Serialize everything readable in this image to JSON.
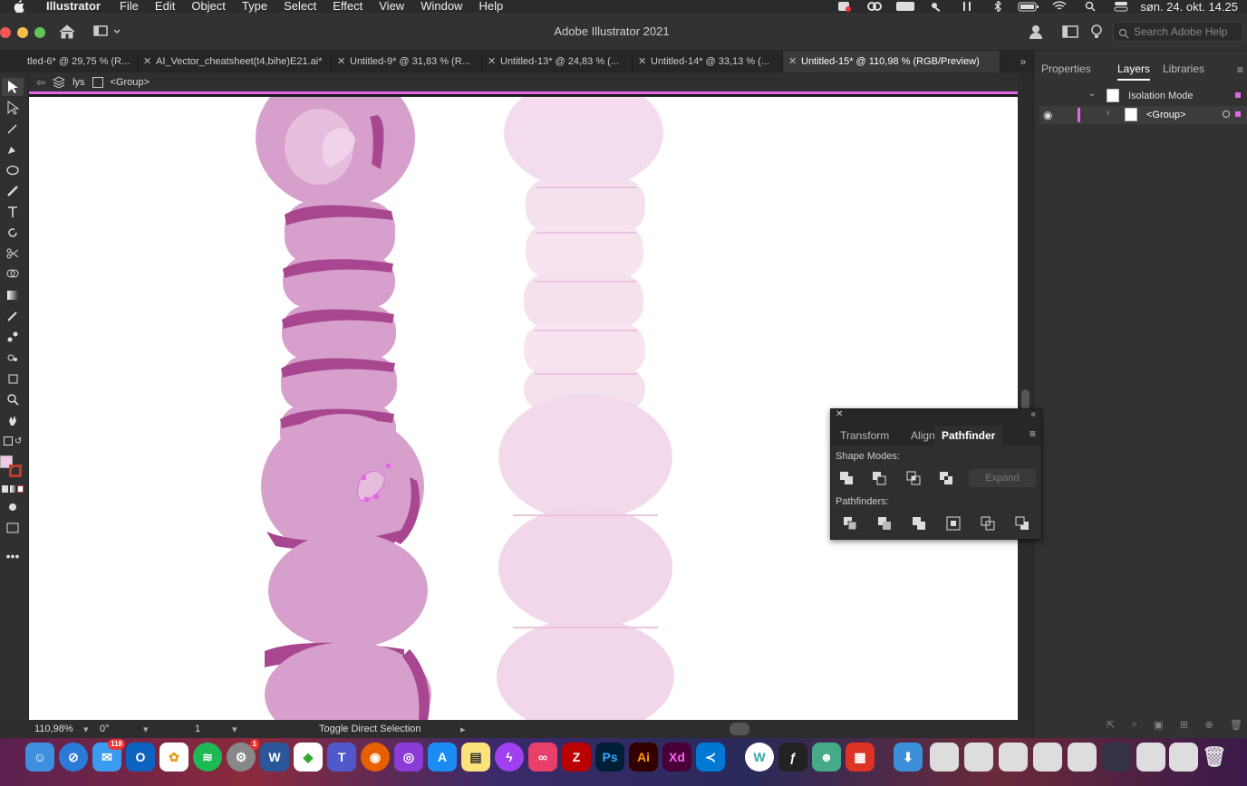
{
  "menubar": {
    "app_name": "Illustrator",
    "items": [
      "File",
      "Edit",
      "Object",
      "Type",
      "Select",
      "Effect",
      "View",
      "Window",
      "Help"
    ],
    "clock": "søn. 24. okt. 14.25",
    "status_icons": [
      "notification-badge-icon",
      "creative-cloud-icon",
      "wd-icon",
      "keychain-icon",
      "tuning-icon",
      "bluetooth-icon",
      "battery-icon",
      "wifi-icon",
      "search-icon",
      "control-center-icon"
    ],
    "notification_badge": "1"
  },
  "window": {
    "title": "Adobe Illustrator 2021",
    "search_placeholder": "Search Adobe Help"
  },
  "tabs": [
    {
      "label": "tled-6* @ 29,75 % (R..."
    },
    {
      "label": "AI_Vector_cheatsheet(t4,bihe)E21.ai*"
    },
    {
      "label": "Untitled-9* @ 31,83 % (R..."
    },
    {
      "label": "Untitled-13* @ 24,83 % (..."
    },
    {
      "label": "Untitled-14* @ 33,13 % (..."
    },
    {
      "label": "Untitled-15* @ 110,98 % (RGB/Preview)"
    }
  ],
  "controlbar": {
    "layer_label": "lys",
    "group_label": "<Group>"
  },
  "statusbar": {
    "zoom": "110,98%",
    "rotation": "0°",
    "artboard": "1",
    "status_text": "Toggle Direct Selection"
  },
  "panels": {
    "tabs": [
      "Properties",
      "Layers",
      "Libraries"
    ],
    "active_tab": "Layers",
    "layers": [
      {
        "name": "Isolation Mode"
      },
      {
        "name": "<Group>"
      }
    ]
  },
  "pathfinder": {
    "tabs": [
      "Transform",
      "Align",
      "Pathfinder"
    ],
    "active_tab": "Pathfinder",
    "shape_modes_label": "Shape Modes:",
    "pathfinders_label": "Pathfinders:",
    "expand_label": "Expand"
  },
  "dock": {
    "mail_badge": "118",
    "settings_badge": "1",
    "apps": [
      "Finder",
      "Safari",
      "Mail",
      "Outlook",
      "Photos",
      "Spotify",
      "System Preferences",
      "Word",
      "Sims",
      "Teams",
      "Firefox",
      "Podcasts",
      "App Store",
      "Notes",
      "Messenger",
      "Creative Cloud",
      "FileZilla",
      "Photoshop",
      "Illustrator",
      "Adobe XD",
      "VS Code",
      "W app",
      "Scripting",
      "Agent",
      "Acrobat",
      "Downloads"
    ]
  },
  "colors": {
    "accent_magenta": "#e266e6",
    "vector_pink": "#d7a0cc",
    "vector_dark": "#a8478f",
    "photo_pink": "#f4d6ea"
  }
}
